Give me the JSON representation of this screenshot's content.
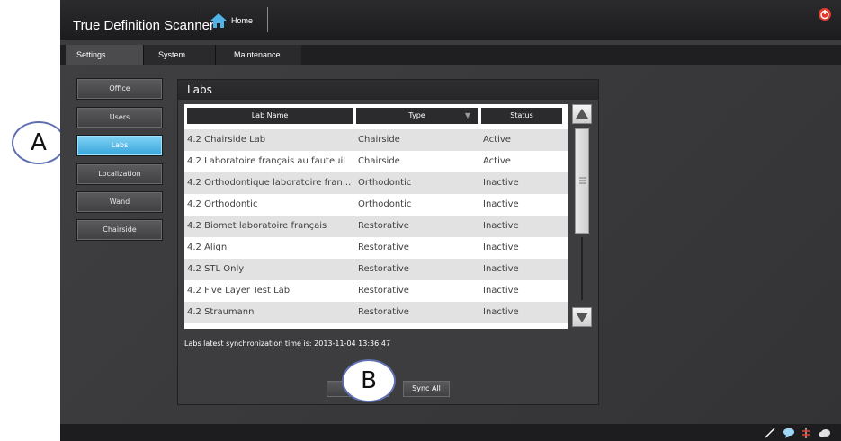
{
  "window": {
    "title": "True Definition Scanner",
    "home_label": "Home"
  },
  "tabs": [
    {
      "label": "Settings",
      "active": true
    },
    {
      "label": "System",
      "active": false
    },
    {
      "label": "Maintenance",
      "active": false
    }
  ],
  "sidebar": {
    "items": [
      {
        "label": "Office",
        "selected": false
      },
      {
        "label": "Users",
        "selected": false
      },
      {
        "label": "Labs",
        "selected": true
      },
      {
        "label": "Localization",
        "selected": false
      },
      {
        "label": "Wand",
        "selected": false
      },
      {
        "label": "Chairside",
        "selected": false
      }
    ]
  },
  "labs_panel": {
    "title": "Labs",
    "columns": [
      "Lab Name",
      "Type",
      "Status"
    ],
    "rows": [
      {
        "name": "4.2 Chairside Lab",
        "type": "Chairside",
        "status": "Active"
      },
      {
        "name": "4.2 Laboratoire français au fauteuil",
        "type": "Chairside",
        "status": "Active"
      },
      {
        "name": "4.2 Orthodontique laboratoire fran...",
        "type": "Orthodontic",
        "status": "Inactive"
      },
      {
        "name": "4.2 Orthodontic",
        "type": "Orthodontic",
        "status": "Inactive"
      },
      {
        "name": "4.2 Biomet laboratoire français",
        "type": "Restorative",
        "status": "Inactive"
      },
      {
        "name": "4.2 Align",
        "type": "Restorative",
        "status": "Inactive"
      },
      {
        "name": "4.2 STL Only",
        "type": "Restorative",
        "status": "Inactive"
      },
      {
        "name": "4.2 Five Layer Test Lab",
        "type": "Restorative",
        "status": "Inactive"
      },
      {
        "name": "4.2 Straumann",
        "type": "Restorative",
        "status": "Inactive"
      }
    ],
    "sync_text": "Labs latest synchronization time is: 2013-11-04 13:36:47",
    "sync_all_label": "Sync All"
  },
  "callouts": {
    "a": "A",
    "b": "B"
  },
  "colors": {
    "accent": "#3aa6dc",
    "power": "#e23b2e"
  },
  "icons": [
    "home-icon",
    "power-icon",
    "sort-down-icon",
    "scroll-up-icon",
    "scroll-down-icon",
    "grip-icon",
    "pen-icon",
    "chat-icon",
    "network-icon",
    "cloud-icon"
  ]
}
